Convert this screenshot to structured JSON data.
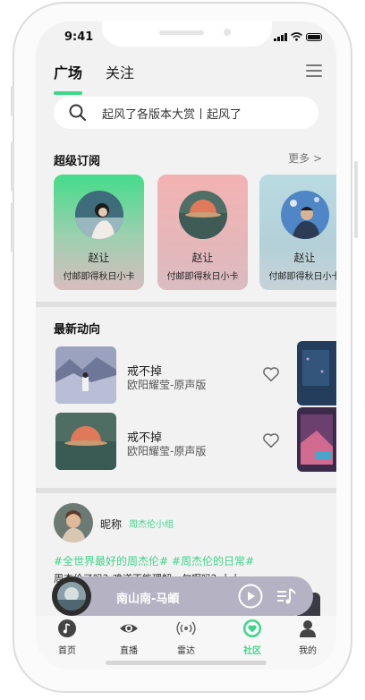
{
  "status_bar": {
    "time": "9:41"
  },
  "header": {
    "tabs": [
      {
        "label": "广场",
        "active": true
      },
      {
        "label": "关注",
        "active": false
      }
    ],
    "menu_icon": "hamburger-menu-icon"
  },
  "search": {
    "placeholder": "起风了各版本大赏丨起风了",
    "icon": "search-icon"
  },
  "subscriptions": {
    "title": "超级订阅",
    "more_label": "更多 >",
    "cards": [
      {
        "name": "赵让",
        "subtitle": "付邮即得秋日小卡"
      },
      {
        "name": "赵让",
        "subtitle": "付邮即得秋日小卡"
      },
      {
        "name": "赵让",
        "subtitle": "付邮即得秋日小卡"
      }
    ]
  },
  "latest": {
    "title": "最新动向",
    "songs": [
      {
        "title": "戒不掉",
        "artist": "欧阳耀莹-原声版"
      },
      {
        "title": "戒不掉",
        "artist": "欧阳耀莹-原声版"
      }
    ]
  },
  "post": {
    "nickname": "昵称",
    "group": "周杰伦小组",
    "tags": "#全世界最好的周杰伦# #周杰伦的日常#",
    "text": "周杰伦了吗？难道不能理解一句啊吗？上上"
  },
  "player": {
    "title": "南山南-马頔"
  },
  "tabbar": [
    {
      "label": "首页",
      "icon": "music-note-icon",
      "active": false
    },
    {
      "label": "直播",
      "icon": "eye-icon",
      "active": false
    },
    {
      "label": "雷达",
      "icon": "radar-icon",
      "active": false
    },
    {
      "label": "社区",
      "icon": "heart-circle-icon",
      "active": true
    },
    {
      "label": "我的",
      "icon": "user-icon",
      "active": false
    }
  ],
  "colors": {
    "accent": "#3ED68A",
    "player_bg": "#B5B2C3"
  }
}
